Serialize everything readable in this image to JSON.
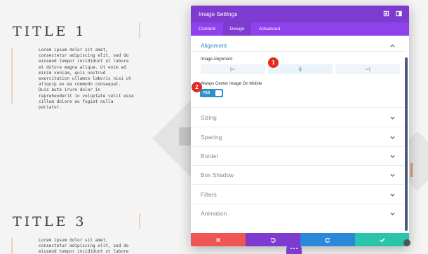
{
  "page": {
    "title1": "TITLE 1",
    "title3": "TITLE 3",
    "body1": "Lorem ipsum dolor sit amet,\nconsectetur adipiscing elit, sed do\neiusmod tempor incididunt ut labore\net dolore magna aliqua. Ut enim ad\nminim veniam, quis nostrud\nexercitation ullamco laboris nisi ut\naliquip ex ea commodo consequat.\nDuis aute irure dolor in\nreprehenderit in voluptate velit esse\ncillum dolore eu fugiat nulla\npariatur.",
    "body3": "Lorem ipsum dolor sit amet,\nconsectetur adipiscing elit, sed do\neiusmod tempor incididunt ut labore"
  },
  "modal": {
    "title": "Image Settings",
    "tabs": [
      {
        "label": "Content",
        "active": false
      },
      {
        "label": "Design",
        "active": true
      },
      {
        "label": "Advanced",
        "active": false
      }
    ],
    "alignment": {
      "heading": "Alignment",
      "image_alignment_label": "Image Alignment",
      "options": [
        "left-align-icon",
        "center-align-icon",
        "right-align-icon"
      ],
      "selected": "center",
      "center_mobile_label": "Always Center Image On Mobile",
      "toggle_value": "YES"
    },
    "sections": [
      "Sizing",
      "Spacing",
      "Border",
      "Box Shadow",
      "Filters",
      "Animation"
    ]
  },
  "markers": [
    "1",
    "2"
  ],
  "colors": {
    "header_purple": "#7e3bd0",
    "tab_purple": "#8f42ec",
    "accent_blue": "#2e92c9",
    "cancel_red": "#ef5555",
    "undo_purple": "#7e3bd0",
    "redo_blue": "#2b87da",
    "save_green": "#29c4a9",
    "marker_red": "#e02b20"
  }
}
